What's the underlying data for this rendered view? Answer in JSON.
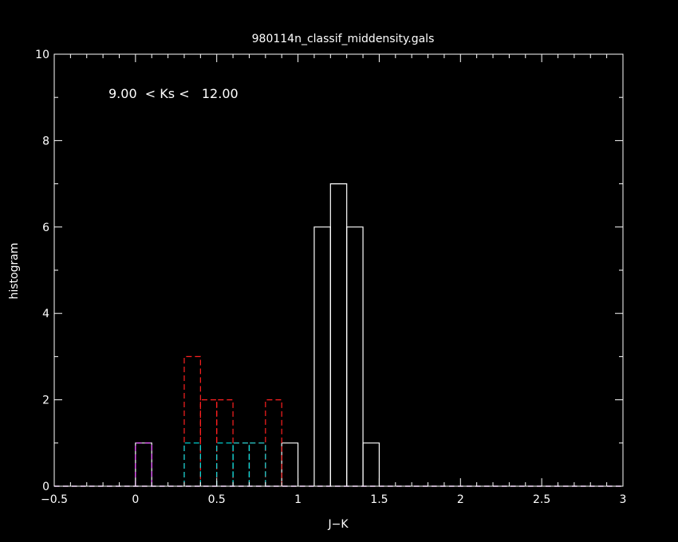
{
  "chart_data": {
    "type": "bar",
    "title": "980114n_classif_middensity.gals",
    "xlabel": "J−K",
    "ylabel": "histogram",
    "annotation": "9.00  < Ks <   12.00",
    "xlim": [
      -0.5,
      3
    ],
    "ylim": [
      0,
      10
    ],
    "bin_width": 0.1,
    "x_ticks": [
      -0.5,
      0,
      0.5,
      1,
      1.5,
      2,
      2.5,
      3
    ],
    "x_tick_labels": [
      "−0.5",
      "0",
      "0.5",
      "1",
      "1.5",
      "2",
      "2.5",
      "3"
    ],
    "y_ticks": [
      0,
      2,
      4,
      6,
      8,
      10
    ],
    "y_tick_labels": [
      "0",
      "2",
      "4",
      "6",
      "8",
      "10"
    ],
    "grid": false,
    "series": [
      {
        "color": "#ffffff",
        "dash": "solid",
        "bins": [
          {
            "x": 0.0,
            "count": 1
          },
          {
            "x": 0.9,
            "count": 1
          },
          {
            "x": 1.1,
            "count": 6
          },
          {
            "x": 1.2,
            "count": 7
          },
          {
            "x": 1.3,
            "count": 6
          },
          {
            "x": 1.4,
            "count": 1
          }
        ]
      },
      {
        "color": "#ff2020",
        "dash": "dashed",
        "bins": [
          {
            "x": 0.0,
            "count": 1
          },
          {
            "x": 0.3,
            "count": 3
          },
          {
            "x": 0.4,
            "count": 2
          },
          {
            "x": 0.5,
            "count": 2
          },
          {
            "x": 0.6,
            "count": 1
          },
          {
            "x": 0.7,
            "count": 1
          },
          {
            "x": 0.8,
            "count": 2
          }
        ]
      },
      {
        "color": "#00e0e0",
        "dash": "dashed",
        "bins": [
          {
            "x": 0.0,
            "count": 1
          },
          {
            "x": 0.3,
            "count": 1
          },
          {
            "x": 0.5,
            "count": 1
          },
          {
            "x": 0.6,
            "count": 1
          },
          {
            "x": 0.7,
            "count": 1
          }
        ]
      },
      {
        "color": "#ff40ff",
        "dash": "dashed",
        "bins": [
          {
            "x": 0.0,
            "count": 1
          }
        ]
      }
    ]
  }
}
